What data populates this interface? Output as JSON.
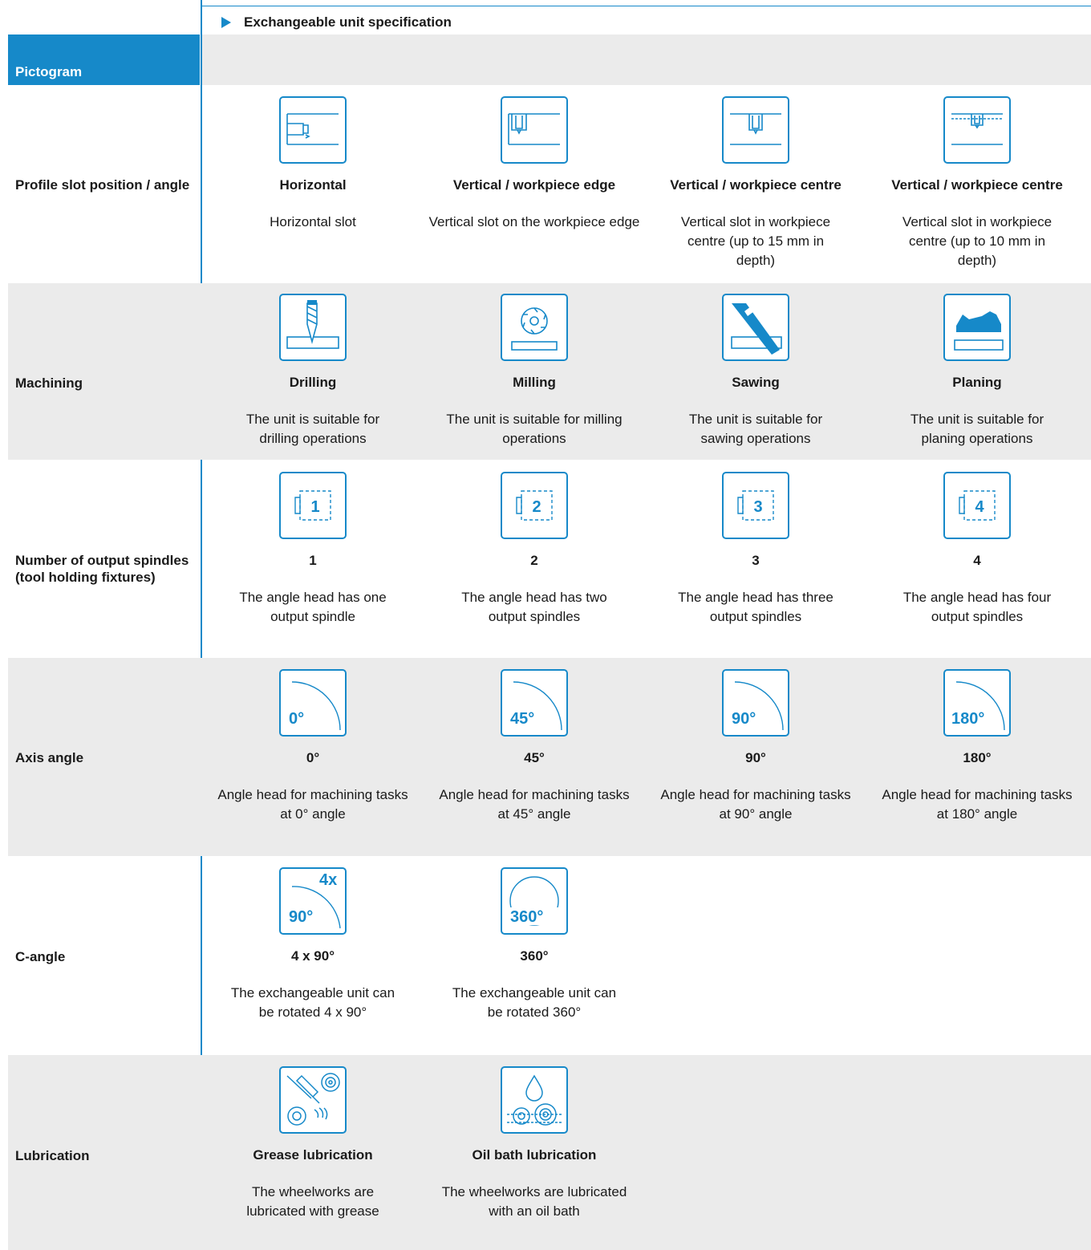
{
  "header": {
    "title": "Exchangeable unit specification"
  },
  "pictogram_label": "Pictogram",
  "colors": {
    "accent": "#1689c9",
    "band": "#ebebeb"
  },
  "rows": {
    "profile": {
      "label": "Profile slot position / angle",
      "items": [
        {
          "icon": "horizontal-slot-icon",
          "title": "Horizontal",
          "desc": "Horizontal slot"
        },
        {
          "icon": "vertical-edge-slot-icon",
          "title": "Vertical / workpiece edge",
          "desc": "Vertical slot on the workpiece edge"
        },
        {
          "icon": "vertical-centre-slot-icon",
          "title": "Vertical / workpiece centre",
          "desc": "Vertical slot in workpiece centre (up to 15 mm in depth)"
        },
        {
          "icon": "vertical-centre-shallow-slot-icon",
          "title": "Vertical / workpiece centre",
          "desc": "Vertical slot in workpiece centre (up to 10 mm in depth)"
        }
      ]
    },
    "machining": {
      "label": "Machining",
      "items": [
        {
          "icon": "drill-icon",
          "title": "Drilling",
          "desc": "The unit is suitable for drilling operations"
        },
        {
          "icon": "milling-cutter-icon",
          "title": "Milling",
          "desc": "The unit is suitable for milling operations"
        },
        {
          "icon": "saw-icon",
          "title": "Sawing",
          "desc": "The unit is suitable for sawing operations"
        },
        {
          "icon": "plane-icon",
          "title": "Planing",
          "desc": "The unit is suitable for planing operations"
        }
      ]
    },
    "spindles": {
      "label": "Number of output spindles (tool holding fixtures)",
      "items": [
        {
          "icon": "spindle-1-icon",
          "glyph": "1",
          "title": "1",
          "desc": "The angle head has one output spindle"
        },
        {
          "icon": "spindle-2-icon",
          "glyph": "2",
          "title": "2",
          "desc": "The angle head has two output spindles"
        },
        {
          "icon": "spindle-3-icon",
          "glyph": "3",
          "title": "3",
          "desc": "The angle head has three output spindles"
        },
        {
          "icon": "spindle-4-icon",
          "glyph": "4",
          "title": "4",
          "desc": "The angle head has four output spindles"
        }
      ]
    },
    "axis": {
      "label": "Axis angle",
      "items": [
        {
          "icon": "angle-0-icon",
          "glyph": "0°",
          "title": "0°",
          "desc": "Angle head for machining tasks at 0° angle"
        },
        {
          "icon": "angle-45-icon",
          "glyph": "45°",
          "title": "45°",
          "desc": "Angle head for machining tasks at 45° angle"
        },
        {
          "icon": "angle-90-icon",
          "glyph": "90°",
          "title": "90°",
          "desc": "Angle head for machining tasks at 90° angle"
        },
        {
          "icon": "angle-180-icon",
          "glyph": "180°",
          "title": "180°",
          "desc": "Angle head for machining tasks at 180° angle"
        }
      ]
    },
    "cangle": {
      "label": "C-angle",
      "items": [
        {
          "icon": "rotate-4x90-icon",
          "glyph_top": "4x",
          "glyph": "90°",
          "title": "4 x 90°",
          "desc": "The exchangeable unit can be rotated 4 x 90°"
        },
        {
          "icon": "rotate-360-icon",
          "glyph": "360°",
          "title": "360°",
          "desc": "The exchangeable unit can be rotated 360°"
        }
      ]
    },
    "lubrication": {
      "label": "Lubrication",
      "items": [
        {
          "icon": "grease-gun-icon",
          "title": "Grease lubrication",
          "desc": "The wheelworks are lubricated with grease"
        },
        {
          "icon": "oil-drop-icon",
          "title": "Oil bath lubrication",
          "desc": "The wheelworks are lubricated with an oil bath"
        }
      ]
    }
  }
}
